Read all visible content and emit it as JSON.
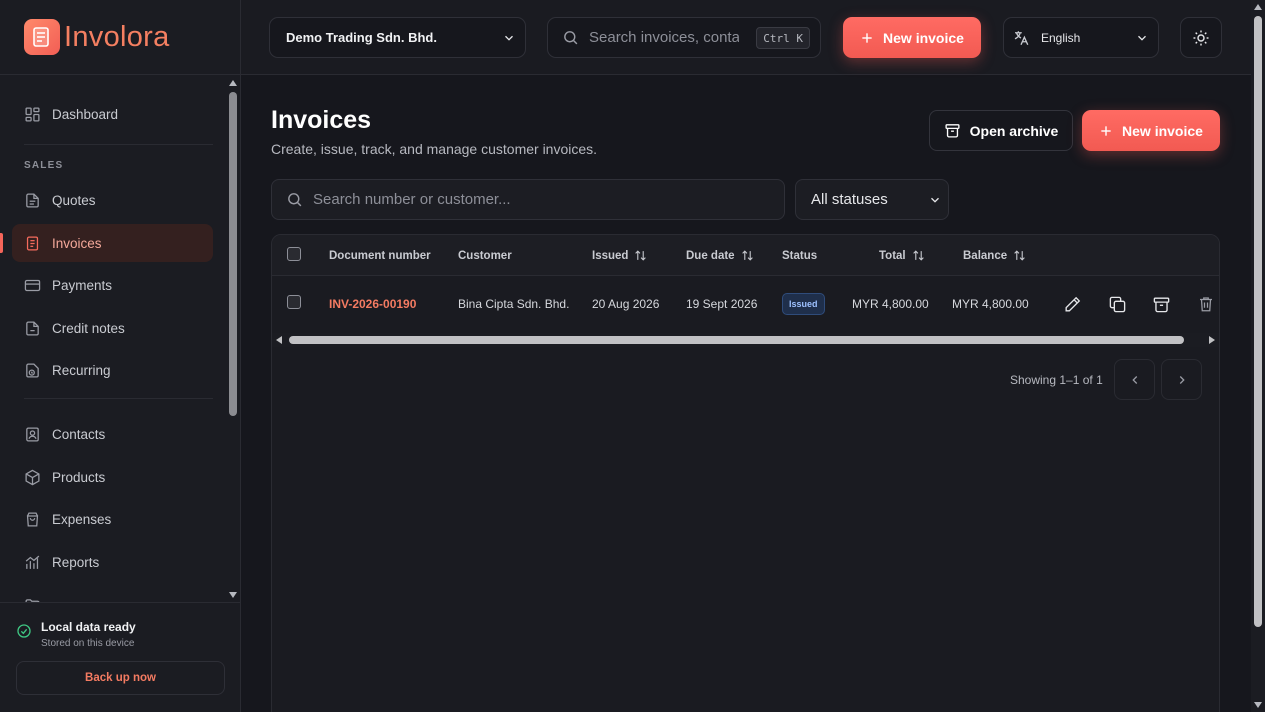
{
  "app": {
    "name": "Involora"
  },
  "topbar": {
    "company": "Demo Trading Sdn. Bhd.",
    "search_placeholder": "Search invoices, contacts...",
    "search_shortcut": "Ctrl K",
    "new_invoice_label": "New invoice",
    "language": "English"
  },
  "sidebar": {
    "items": [
      {
        "label": "Dashboard",
        "icon": "dashboard-icon"
      },
      {
        "label": "Quotes",
        "icon": "document-icon"
      },
      {
        "label": "Invoices",
        "icon": "invoice-icon",
        "active": true
      },
      {
        "label": "Payments",
        "icon": "credit-card-icon"
      },
      {
        "label": "Credit notes",
        "icon": "credit-note-icon"
      },
      {
        "label": "Recurring",
        "icon": "recurring-icon"
      },
      {
        "label": "Contacts",
        "icon": "contacts-icon"
      },
      {
        "label": "Products",
        "icon": "box-icon"
      },
      {
        "label": "Expenses",
        "icon": "bag-icon"
      },
      {
        "label": "Reports",
        "icon": "chart-icon"
      }
    ],
    "section_sales": "SALES",
    "footer": {
      "status_title": "Local data ready",
      "status_sub": "Stored on this device",
      "backup_label": "Back up now"
    }
  },
  "page": {
    "title": "Invoices",
    "subtitle": "Create, issue, track, and manage customer invoices.",
    "open_archive_label": "Open archive",
    "new_invoice_label": "New invoice",
    "search_placeholder": "Search number or customer...",
    "status_filter": "All statuses"
  },
  "table": {
    "columns": [
      "Document number",
      "Customer",
      "Issued",
      "Due date",
      "Status",
      "Total",
      "Balance"
    ],
    "rows": [
      {
        "number": "INV-2026-00190",
        "customer": "Bina Cipta Sdn. Bhd.",
        "issued": "20 Aug 2026",
        "due": "19 Sept 2026",
        "status": "Issued",
        "total": "MYR 4,800.00",
        "balance": "MYR 4,800.00"
      }
    ],
    "pager_text": "Showing 1–1 of 1"
  },
  "colors": {
    "accent": "#f25a52",
    "accent_text": "#f47b62",
    "background": "#16171d",
    "badge_issued": "#1f2f4b"
  }
}
